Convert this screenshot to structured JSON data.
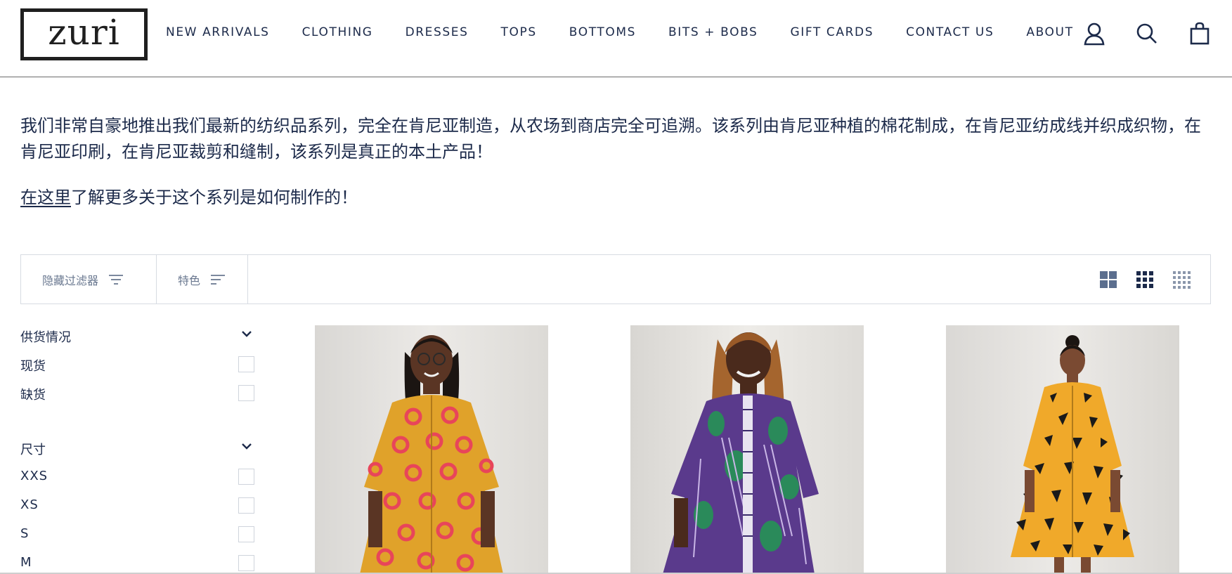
{
  "header": {
    "logo_text": "zuri",
    "nav": [
      "NEW ARRIVALS",
      "CLOTHING",
      "DRESSES",
      "TOPS",
      "BOTTOMS",
      "BITS + BOBS",
      "GIFT CARDS",
      "CONTACT US",
      "ABOUT"
    ],
    "icons": [
      "account-icon",
      "search-icon",
      "cart-icon"
    ]
  },
  "intro": {
    "text": "我们非常自豪地推出我们最新的纺织品系列，完全在肯尼亚制造，从农场到商店完全可追溯。该系列由肯尼亚种植的棉花制成，在肯尼亚纺成线并织成织物，在肯尼亚印刷，在肯尼亚裁剪和缝制，该系列是真正的本土产品！",
    "link_text": "在这里",
    "link_suffix": "了解更多关于这个系列是如何制作的！"
  },
  "toolbar": {
    "filter_label": "隐藏过滤器",
    "sort_label": "特色",
    "view_icons": [
      "grid-2-icon",
      "grid-3-icon",
      "grid-4-icon"
    ]
  },
  "filters": {
    "availability": {
      "title": "供货情况",
      "options": [
        "现货",
        "缺货"
      ]
    },
    "size": {
      "title": "尺寸",
      "options": [
        "XXS",
        "XS",
        "S",
        "M"
      ]
    }
  },
  "products": [
    {
      "image": "yellow-pink-print-shirt-dress",
      "dress_color": "#e0a22a",
      "accent": "#e8455a"
    },
    {
      "image": "purple-print-shirt-dress",
      "dress_color": "#5a3a8c",
      "accent": "#2a8a5a"
    },
    {
      "image": "yellow-black-print-shirt-dress",
      "dress_color": "#f0a92a",
      "accent": "#1a1a1a"
    }
  ],
  "colors": {
    "text": "#1c2a4a",
    "muted": "#6a7890",
    "border": "#d7dbe2"
  }
}
